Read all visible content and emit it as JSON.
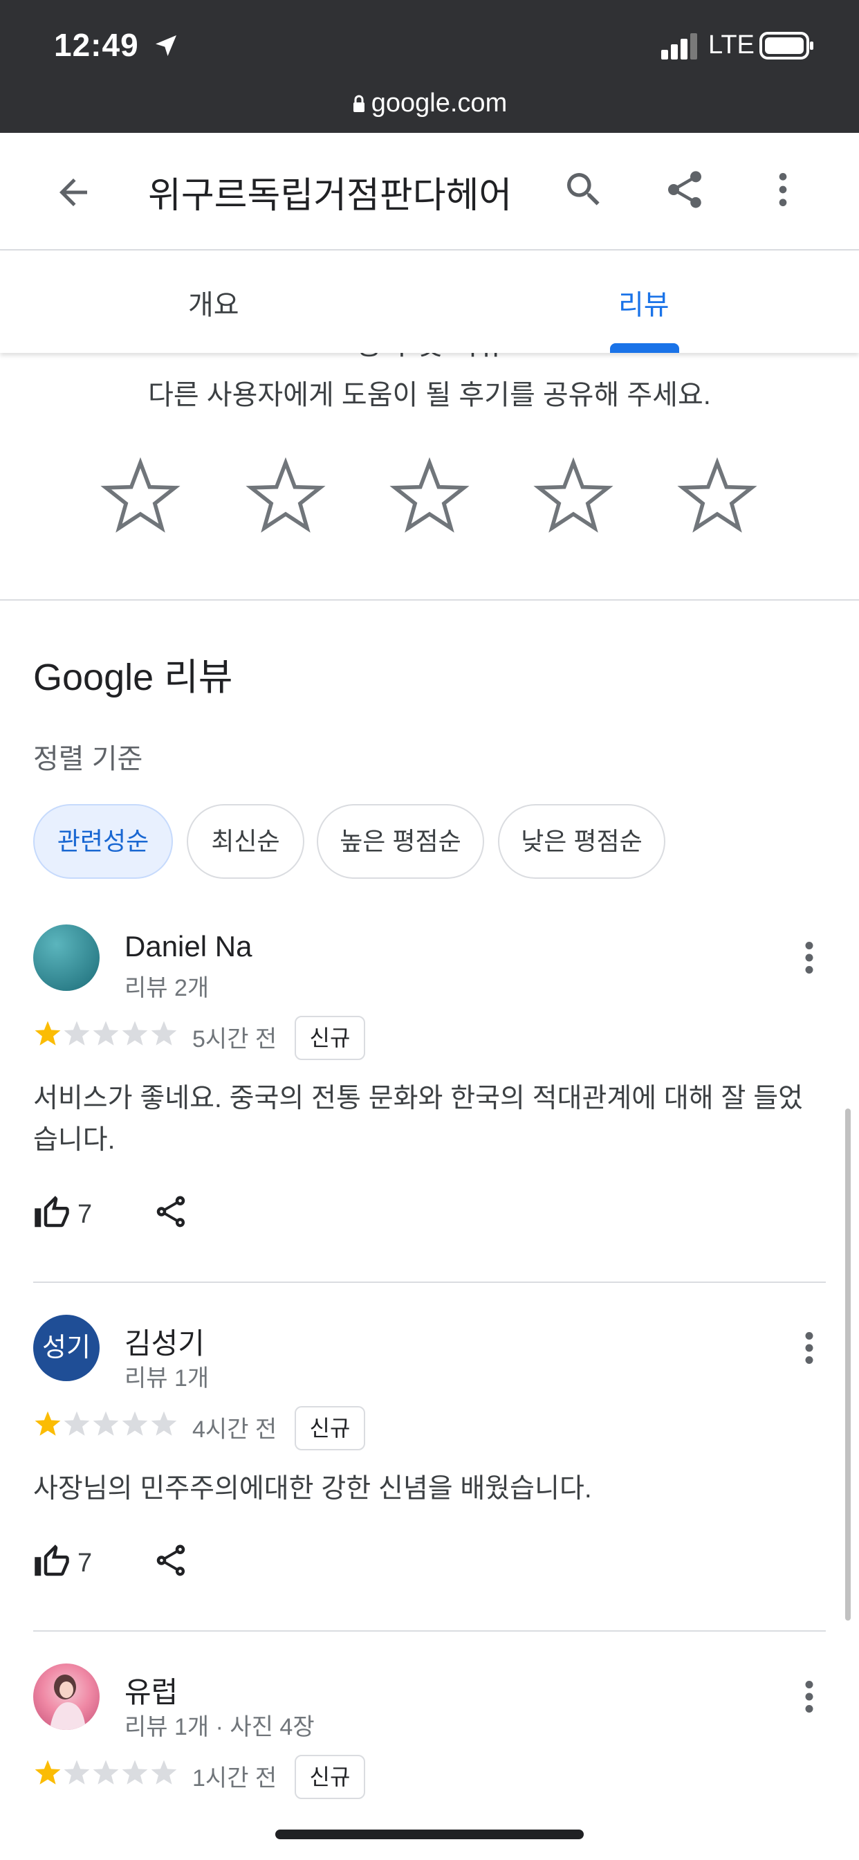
{
  "status_bar": {
    "time": "12:49",
    "network": "LTE",
    "url": "google.com"
  },
  "header": {
    "title": "위구르독립거점판다헤어"
  },
  "tabs": [
    {
      "label": "개요"
    },
    {
      "label": "리뷰",
      "selected": true
    }
  ],
  "rate": {
    "heading": "평가 및 리뷰",
    "prompt": "다른 사용자에게 도움이 될 후기를 공유해 주세요."
  },
  "reviews_section": {
    "title": "Google 리뷰",
    "sort_label": "정렬 기준",
    "sort_options": [
      {
        "label": "관련성순",
        "selected": true
      },
      {
        "label": "최신순"
      },
      {
        "label": "높은 평점순"
      },
      {
        "label": "낮은 평점순"
      }
    ]
  },
  "reviews": [
    {
      "name": "Daniel Na",
      "meta": "리뷰 2개",
      "rating": 1,
      "time_ago": "5시간 전",
      "badge": "신규",
      "text": "서비스가 좋네요. 중국의 전통 문화와 한국의 적대관계에 대해 잘 들었습니다.",
      "likes": "7"
    },
    {
      "name": "김성기",
      "avatar_text": "성기",
      "meta": "리뷰 1개",
      "rating": 1,
      "time_ago": "4시간 전",
      "badge": "신규",
      "text": "사장님의 민주주의에대한 강한 신념을 배웠습니다.",
      "likes": "7"
    },
    {
      "name": "유럽",
      "meta": "리뷰 1개 · 사진 4장",
      "rating": 1,
      "time_ago": "1시간 전",
      "badge": "신규"
    }
  ],
  "colors": {
    "accent": "#1a73e8",
    "star_filled": "#fbbc04",
    "star_empty": "#dadce0",
    "status_bar": "#303134"
  }
}
